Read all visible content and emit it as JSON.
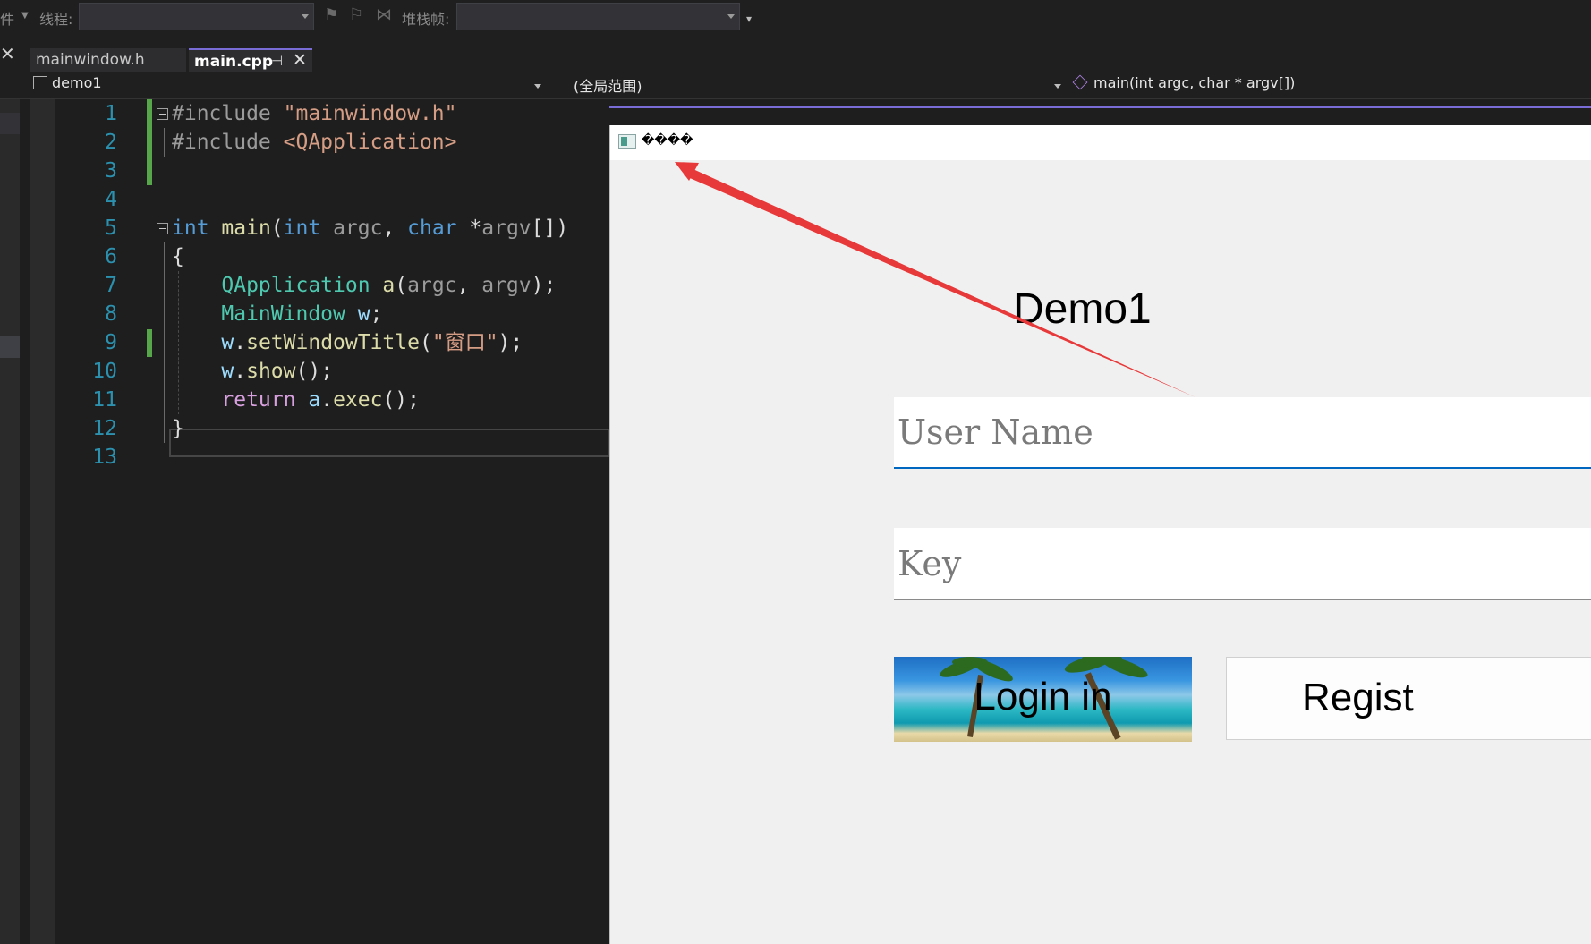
{
  "toolbar": {
    "event_label": "件",
    "thread_label": "线程:",
    "thread_value": "",
    "stack_label": "堆栈帧:",
    "stack_value": ""
  },
  "tabs": {
    "inactive_label": "mainwindow.h",
    "active_label": "main.cpp"
  },
  "navbar": {
    "project": "demo1",
    "scope": "(全局范围)",
    "member": "main(int argc, char * argv[])"
  },
  "editor": {
    "line_numbers": [
      "1",
      "2",
      "3",
      "4",
      "5",
      "6",
      "7",
      "8",
      "9",
      "10",
      "11",
      "12",
      "13"
    ],
    "current_line": "9"
  },
  "qt_app": {
    "window_title": "����",
    "heading": "Demo1",
    "username_placeholder": "User Name",
    "key_placeholder": "Key",
    "login_label": "Login in",
    "register_label": "Regist"
  },
  "colors": {
    "accent": "#7a6cd6",
    "modified_bar": "#57a64a",
    "annotation_arrow": "#e8393a",
    "focus_underline": "#0067c0"
  }
}
